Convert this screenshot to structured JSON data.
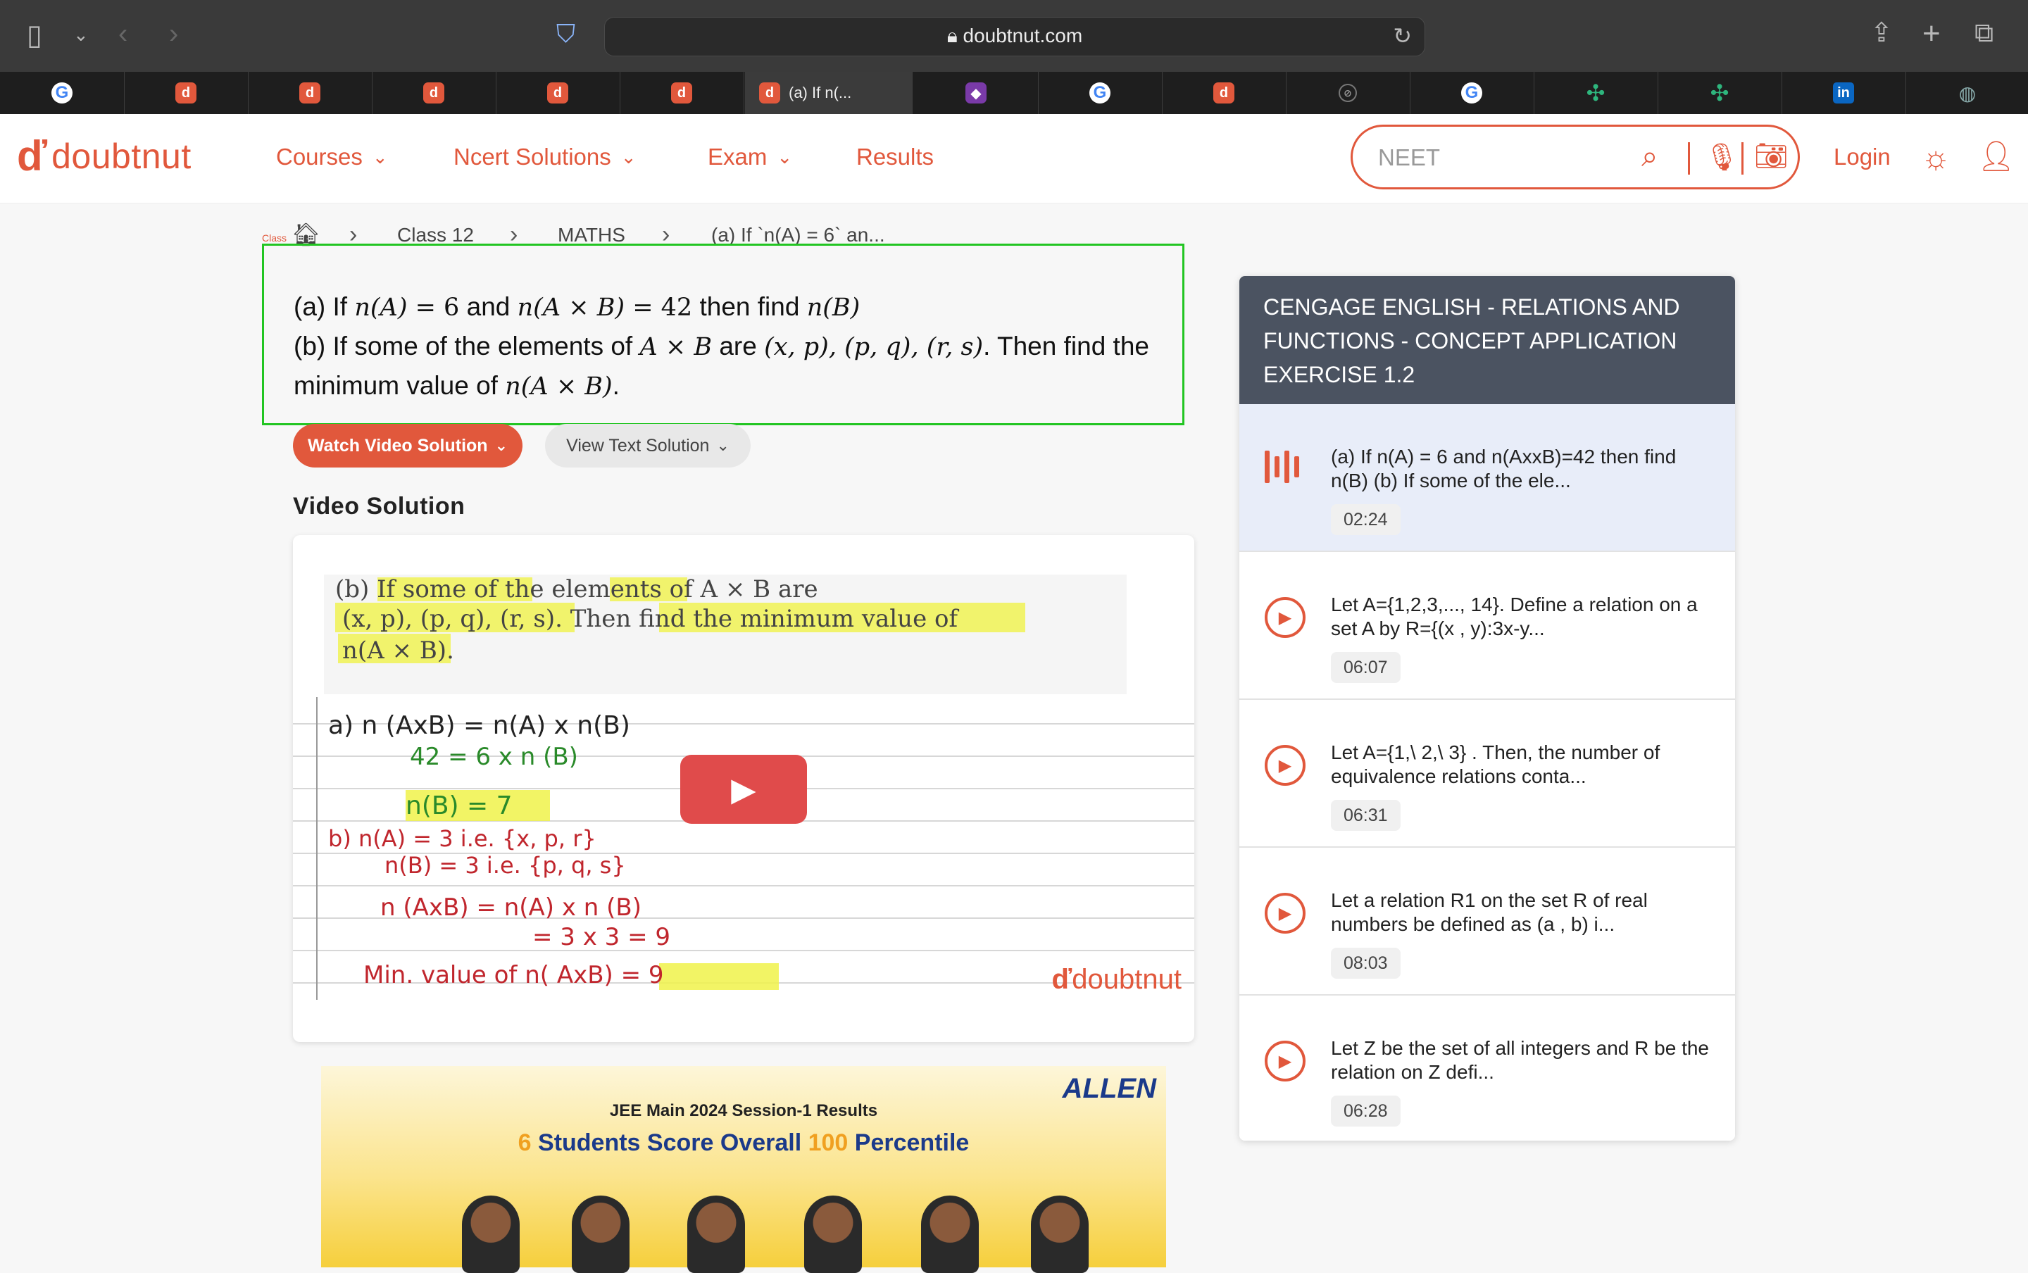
{
  "browser": {
    "url": "doubtnut.com",
    "active_tab_title": "(a) If n(...",
    "tabs": [
      "google",
      "doubtnut",
      "doubtnut",
      "doubtnut",
      "doubtnut",
      "doubtnut",
      "doubtnut-active",
      "obsidian",
      "google",
      "doubtnut",
      "compass",
      "google",
      "slack",
      "slack",
      "linkedin",
      "globe"
    ]
  },
  "header": {
    "brand": "doubtnut",
    "nav": [
      {
        "label": "Courses",
        "has_dropdown": true
      },
      {
        "label": "Ncert Solutions",
        "has_dropdown": true
      },
      {
        "label": "Exam",
        "has_dropdown": true
      },
      {
        "label": "Results",
        "has_dropdown": false
      }
    ],
    "search_value": "NEET",
    "login_label": "Login"
  },
  "breadcrumb": {
    "home_hint": "Class",
    "items": [
      "Class 12",
      "MATHS",
      "(a) If `n(A) = 6` an..."
    ]
  },
  "question": {
    "a_label": "(a) If",
    "a_and": "and",
    "a_then": "then find",
    "b_label": "(b) If some of the elements of",
    "b_are": "are",
    "b_then": ". Then find the",
    "c_line": "minimum value of",
    "math": {
      "nA": "n(A)",
      "eq6": " = 6",
      "nAxB": "n(A × B)",
      "eq42": " = 42",
      "nB": "n(B)",
      "AxB": "A × B",
      "pairs": "(x, p), (p, q), (r, s)",
      "nAxB_end": "n(A × B)",
      "period": "."
    }
  },
  "buttons": {
    "watch": "Watch Video Solution",
    "text": "View Text Solution"
  },
  "video": {
    "heading": "Video Solution",
    "watermark": "doubtnut",
    "printed_question_l1": "(b) If some of the elements of A × B are",
    "printed_question_l2": "(x, p), (p, q), (r, s). Then find the minimum value of",
    "printed_question_l3": "n(A × B).",
    "handwriting": [
      "a)  n (AxB)  = n(A) x  n(B)",
      "42 =  6 x n (B)",
      "n(B) = 7",
      "b)  n(A) = 3     i.e.  {x, p, r}",
      "n(B) = 3     i.e.  {p, q, s}",
      "n (AxB) =  n(A) x n (B)",
      "= 3 x 3  = 9",
      "Min. value   of   n( AxB) = 9"
    ]
  },
  "ad": {
    "brand": "ALLEN",
    "line1": "JEE Main 2024 Session-1 Results",
    "line2_a": "6 Students Score Overall ",
    "line2_b": "100",
    "line2_c": " Percentile"
  },
  "sidebar": {
    "title": "CENGAGE ENGLISH  -  RELATIONS AND FUNCTIONS  -  CONCEPT APPLICATION EXERCISE 1.2",
    "items": [
      {
        "text": "(a) If n(A) = 6 and n(AxxB)=42 then find n(B) (b) If some of the ele...",
        "duration": "02:24",
        "active": true
      },
      {
        "text": "Let A={1,2,3,..., 14}. Define a relation on a set A by R={(x , y):3x-y...",
        "duration": "06:07",
        "active": false
      },
      {
        "text": "Let A={1,\\ 2,\\ 3} . Then, the number of equivalence relations conta...",
        "duration": "06:31",
        "active": false
      },
      {
        "text": "Let a relation R1 on the set R of real numbers be defined as (a , b) i...",
        "duration": "08:03",
        "active": false
      },
      {
        "text": "Let Z be the set of all integers and R be the relation on Z defi...",
        "duration": "06:28",
        "active": false
      }
    ]
  },
  "colors": {
    "brand": "#e1583c",
    "highlight_box": "#22c522",
    "sidebar_header": "#4b5361",
    "active_item_bg": "#e8edf9"
  }
}
